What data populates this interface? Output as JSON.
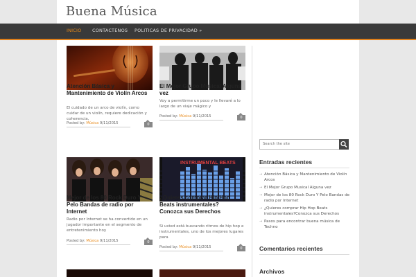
{
  "site": {
    "title": "Buena Música"
  },
  "nav": {
    "items": [
      "INICIO",
      "CONTACTENOS",
      "POLITICAS DE PRIVACIDAD »"
    ]
  },
  "posts": [
    {
      "title": "Atención Básica y Mantenimiento de Violín Arcos",
      "excerpt": "El cuidado de un arco de violín, como cuidar de un violín, requiere dedicación y coherencia,",
      "meta_prefix": "Posted by:",
      "category": "Música",
      "date": "9/11/2015",
      "comments": "0"
    },
    {
      "title": "El Mejor Grupo Musical Alguna vez",
      "excerpt": "Voy a permitirme un poco y le llevaré a lo largo de un viaje mágico y",
      "meta_prefix": "Posted by:",
      "category": "Música",
      "date": "9/11/2015",
      "comments": "0"
    },
    {
      "title": "Mejor de los 80 Rock Duro Y Pelo Bandas de radio por Internet",
      "excerpt": "Radio por Internet se ha convertido en un jugador importante en el segmento de entretenimiento hoy",
      "meta_prefix": "Posted by:",
      "category": "Música",
      "date": "9/11/2015",
      "comments": "0"
    },
    {
      "title": "¿Quieres comprar Hip Hop Beats instrumentales? Conozca sus Derechos",
      "excerpt": "Si usted está buscando ritmos de hip hop e instrumentales, uno de los mejores lugares para",
      "meta_prefix": "Posted by:",
      "category": "Música",
      "date": "9/11/2015",
      "comments": "0"
    }
  ],
  "thumb_text": {
    "instrumental": "INSTRUMENTAL BEATS"
  },
  "sidebar": {
    "search_placeholder": "Search the site",
    "recent_title": "Entradas recientes",
    "recent_items": [
      "Atención Básica y Mantenimiento de Violín Arcos",
      "El Mejor Grupo Musical Alguna vez",
      "Mejor de los 80 Rock Duro Y Pelo Bandas de radio por Internet",
      "¿Quieres comprar Hip Hop Beats instrumentales?Conozca sus Derechos",
      "Pasos para encontrar buena música de Techno"
    ],
    "comments_title": "Comentarios recientes",
    "archives_title": "Archivos"
  },
  "colors": {
    "accent": "#e88a1a",
    "nav_bg": "#3a3a3a",
    "page_bg": "#e8e8e8"
  }
}
